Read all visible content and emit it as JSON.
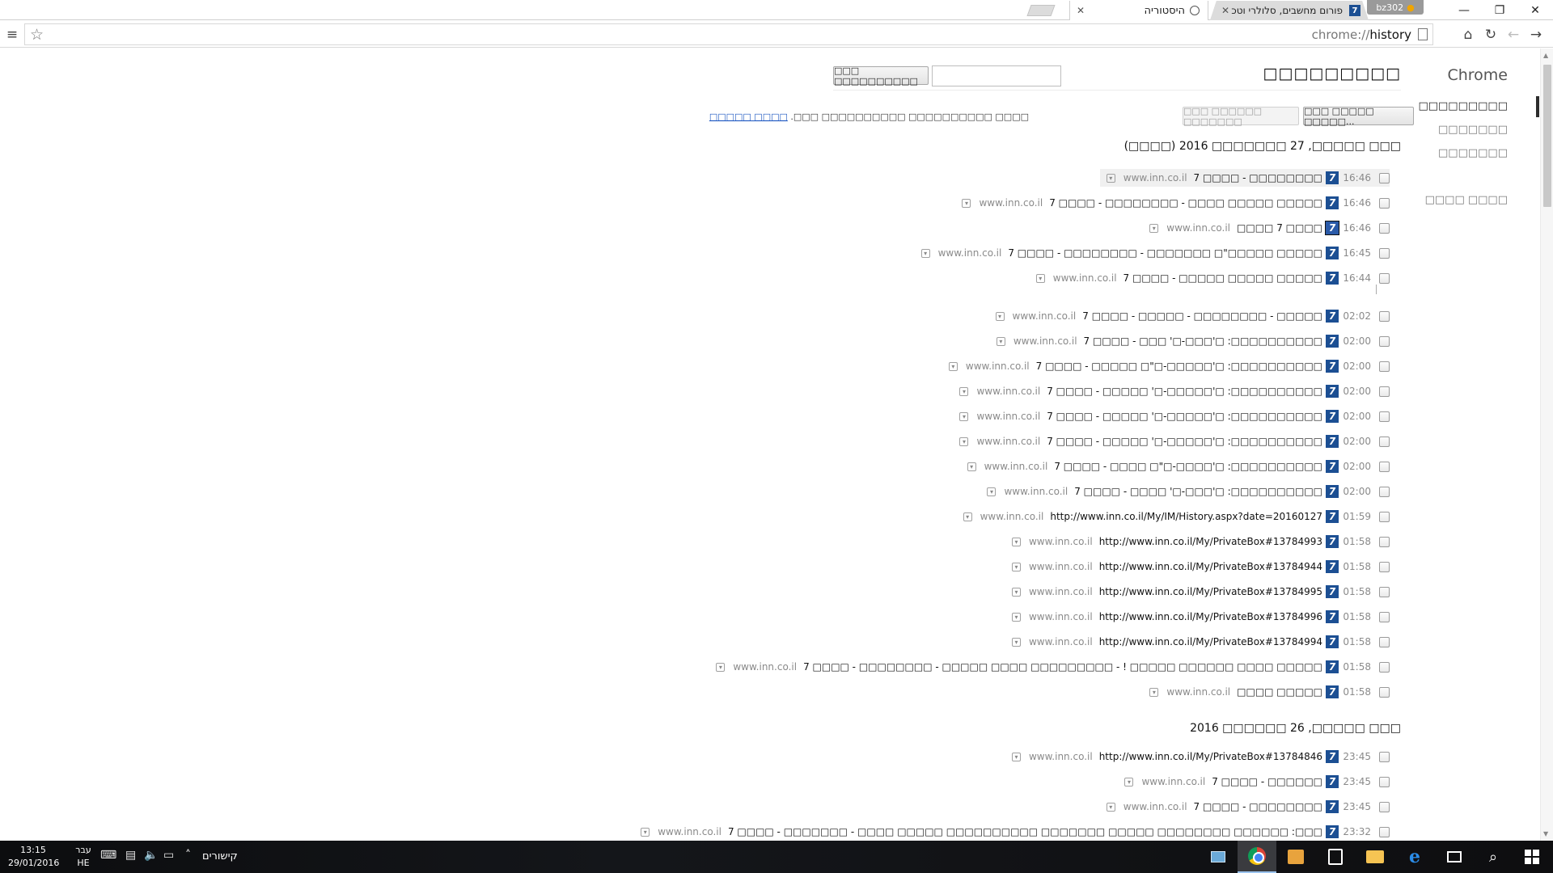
{
  "window": {
    "profile_name": "bz302",
    "tabs": [
      {
        "title": "פורום מחשבים, סלולרי וטכ",
        "active": false
      },
      {
        "title": "היסטוריה",
        "active": true
      }
    ],
    "controls": {
      "minimize": "—",
      "maximize": "❐",
      "close": "✕"
    }
  },
  "toolbar": {
    "url_prefix": "chrome://",
    "url_path": "history",
    "icons": [
      "menu-icon",
      "star-icon",
      "page-icon",
      "home-icon",
      "reload-icon",
      "back-icon",
      "forward-icon"
    ]
  },
  "sidebar": {
    "logo": "Chrome",
    "items": [
      "□□□□□□□□□",
      "□□□□□□□",
      "□□□□□□□",
      "□□□□ □□□□"
    ]
  },
  "header": {
    "title": "□□□□□□□□□",
    "search_button": "□□□ □□□□□□□□□□",
    "clear_button": "□□□ □□□□□ □□□□□...",
    "remove_button": "□□□ □□□□□□ □□□□□□□",
    "info_text": "□□□□ □□□□□□□□□□ □□□□□□□□□□ □□□.",
    "info_link": "□□□□ □□□□□"
  },
  "days": [
    {
      "header": "□□□ □□□□□, 27 □□□□□□□ 2016 (□□□□)",
      "entries": [
        {
          "time": "16:46",
          "title": "□□□□□□□□ - □□□□ 7",
          "domain": "www.inn.co.il",
          "highlighted": true
        },
        {
          "time": "16:46",
          "title": "□□□□□ □□□□□ □□□□ - □□□□□□□□ - □□□□ 7",
          "domain": "www.inn.co.il"
        },
        {
          "time": "16:46",
          "title": "□□□□ 7 □□□□",
          "domain": "www.inn.co.il",
          "checked_favicon": true
        },
        {
          "time": "16:45",
          "title": "□□□□□ □□□□□\"□ □□□□□□□ - □□□□□□□□ - □□□□ 7",
          "domain": "www.inn.co.il"
        },
        {
          "time": "16:44",
          "title": "□□□□□ □□□□□ □□□□□ - □□□□ 7",
          "domain": "www.inn.co.il"
        },
        {
          "time": "02:02",
          "title": "□□□□□ - □□□□□□□□ - □□□□□ - □□□□ 7",
          "domain": "www.inn.co.il"
        },
        {
          "time": "02:00",
          "title": "□□□□□□□□□□: □'□□□-□' □□□ - □□□□ 7",
          "domain": "www.inn.co.il"
        },
        {
          "time": "02:00",
          "title": "□□□□□□□□□□: □'□□□□□-□\"□ □□□□□ - □□□□ 7",
          "domain": "www.inn.co.il"
        },
        {
          "time": "02:00",
          "title": "□□□□□□□□□□: □'□□□□□-□' □□□□□ - □□□□ 7",
          "domain": "www.inn.co.il"
        },
        {
          "time": "02:00",
          "title": "□□□□□□□□□□: □'□□□□□-□' □□□□□ - □□□□ 7",
          "domain": "www.inn.co.il"
        },
        {
          "time": "02:00",
          "title": "□□□□□□□□□□: □'□□□□□-□' □□□□□ - □□□□ 7",
          "domain": "www.inn.co.il"
        },
        {
          "time": "02:00",
          "title": "□□□□□□□□□□: □'□□□□-□\"□ □□□□ - □□□□ 7",
          "domain": "www.inn.co.il"
        },
        {
          "time": "02:00",
          "title": "□□□□□□□□□□: □'□□□-□' □□□□ - □□□□ 7",
          "domain": "www.inn.co.il"
        },
        {
          "time": "01:59",
          "title": "http://www.inn.co.il/My/IM/History.aspx?date=20160127",
          "domain": "www.inn.co.il"
        },
        {
          "time": "01:58",
          "title": "http://www.inn.co.il/My/PrivateBox#13784993",
          "domain": "www.inn.co.il"
        },
        {
          "time": "01:58",
          "title": "http://www.inn.co.il/My/PrivateBox#13784944",
          "domain": "www.inn.co.il"
        },
        {
          "time": "01:58",
          "title": "http://www.inn.co.il/My/PrivateBox#13784995",
          "domain": "www.inn.co.il"
        },
        {
          "time": "01:58",
          "title": "http://www.inn.co.il/My/PrivateBox#13784996",
          "domain": "www.inn.co.il"
        },
        {
          "time": "01:58",
          "title": "http://www.inn.co.il/My/PrivateBox#13784994",
          "domain": "www.inn.co.il"
        },
        {
          "time": "01:58",
          "title": "□□□□□ □□□□ □□□□□□ □□□□□ ! - □□□□□□□□□ □□□□ □□□□□ - □□□□□□□□ - □□□□ 7",
          "domain": "www.inn.co.il"
        },
        {
          "time": "01:58",
          "title": "□□□□□ □□□□",
          "domain": "www.inn.co.il"
        }
      ]
    },
    {
      "header": "□□□ □□□□□, 26 □□□□□□ 2016",
      "entries": [
        {
          "time": "23:45",
          "title": "http://www.inn.co.il/My/PrivateBox#13784846",
          "domain": "www.inn.co.il"
        },
        {
          "time": "23:45",
          "title": "□□□□□□ - □□□□ 7",
          "domain": "www.inn.co.il"
        },
        {
          "time": "23:45",
          "title": "□□□□□□□□ - □□□□ 7",
          "domain": "www.inn.co.il"
        },
        {
          "time": "23:32",
          "title": "□□□: □□□□□□ □□□□□□□□ □□□□□ □□□□□□□ □□□□□□□□□□ □□□□□ □□□□ - □□□□□□□ - □□□□ 7",
          "domain": "www.inn.co.il"
        }
      ]
    }
  ],
  "taskbar": {
    "time": "13:15",
    "date": "29/01/2016",
    "lang_top": "עבר",
    "lang_bottom": "HE",
    "links_label": "קישורים"
  }
}
